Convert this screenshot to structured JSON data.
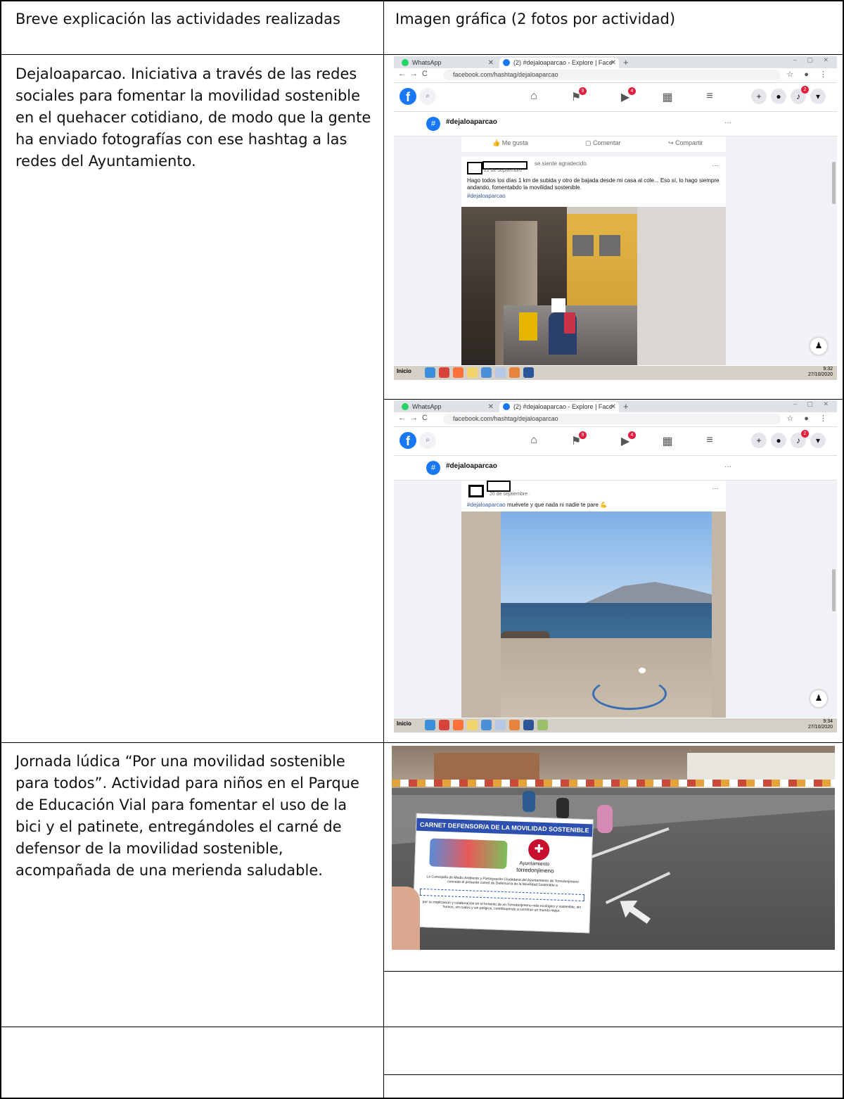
{
  "header": {
    "col1": "Breve explicación las actividades realizadas",
    "col2": "Imagen gráfica (2 fotos por actividad)"
  },
  "rows": [
    {
      "text": "Dejaloaparcao. Iniciativa a través de las redes sociales para fomentar la movilidad sostenible en el quehacer cotidiano, de modo que la gente ha enviado fotografías con ese hashtag a las redes del Ayuntamiento."
    },
    {
      "text": "Jornada lúdica “Por una movilidad sostenible para todos”. Actividad para niños en el Parque de Educación Vial para fomentar el uso de la bici y el patinete, entregándoles el carné de defensor de la movilidad sostenible, acompañada de una merienda saludable."
    }
  ],
  "screenshots": [
    {
      "tab_whatsapp": "WhatsApp",
      "tab_facebook": "(2) #dejaloaparcao - Explore | Face",
      "url": "facebook.com/hashtag/dejaloaparcao",
      "hashtag_title": "#dejaloaparcao",
      "like": "Me gusta",
      "comment": "Comentar",
      "share": "Compartir",
      "post_status": "se siente agradecido.",
      "post_date": "22 de septiembre ·",
      "post_text": "Hago todos los días 1 km de subida y otro de bajada desde mi casa al cole... Eso sí, lo hago siempre andando, fomentabdo la movilidad sostenible.",
      "post_tag": "#dejaloaparcao",
      "badge_flag": "9",
      "badge_video": "4",
      "badge_bell": "2",
      "start": "Inicio",
      "clock_time": "9:32",
      "clock_date": "27/10/2020"
    },
    {
      "tab_whatsapp": "WhatsApp",
      "tab_facebook": "(2) #dejaloaparcao - Explore | Face",
      "url": "facebook.com/hashtag/dejaloaparcao",
      "hashtag_title": "#dejaloaparcao",
      "post_date": "20 de septiembre ·",
      "post_tag": "#dejaloaparcao",
      "post_text": "muévete y que nada ni nadie te pare",
      "badge_flag": "9",
      "badge_video": "4",
      "badge_bell": "2",
      "start": "Inicio",
      "clock_time": "9:34",
      "clock_date": "27/10/2020"
    }
  ],
  "card": {
    "title": "CARNET DEFENSOR/A DE LA MOVILIDAD SOSTENIBLE",
    "ayto": "Ayuntamiento",
    "town": "torredonjimeno",
    "body": "La Concejalía de Medio Ambiente y Participación Ciudadana del Ayuntamiento de Torredonjimeno concede el presente carnet de Defensor/a de la Movilidad Sostenible a",
    "footer": "por su implicación y colaboración en el fomento de un Torredonjimeno más ecológico y sostenible, sin humos, sin ruidos y sin peligros, contribuyendo a construir un mundo mejor."
  }
}
